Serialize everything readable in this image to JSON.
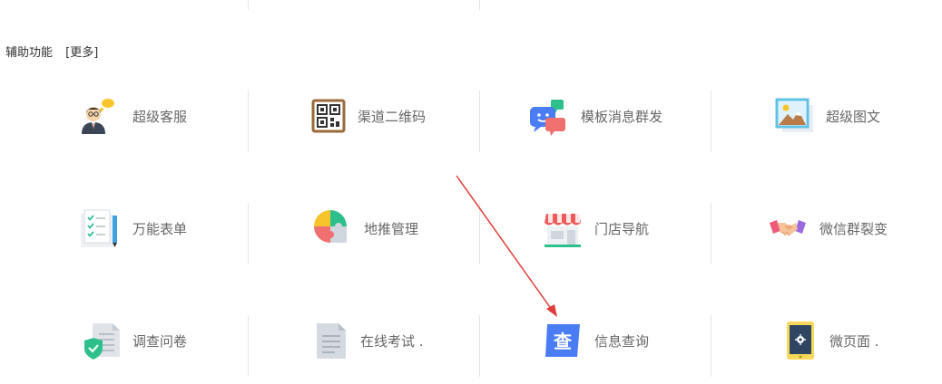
{
  "section": {
    "title": "辅助功能",
    "more_label": "[更多]"
  },
  "tiles": [
    {
      "label": "超级客服",
      "icon": "customer-service-icon"
    },
    {
      "label": "渠道二维码",
      "icon": "qr-code-icon"
    },
    {
      "label": "模板消息群发",
      "icon": "message-chat-icon"
    },
    {
      "label": "超级图文",
      "icon": "picture-article-icon"
    },
    {
      "label": "万能表单",
      "icon": "form-checklist-icon"
    },
    {
      "label": "地推管理",
      "icon": "puzzle-icon"
    },
    {
      "label": "门店导航",
      "icon": "store-icon"
    },
    {
      "label": "微信群裂变",
      "icon": "handshake-icon"
    },
    {
      "label": "调查问卷",
      "icon": "survey-shield-icon"
    },
    {
      "label": "在线考试 .",
      "icon": "exam-document-icon"
    },
    {
      "label": "信息查询",
      "icon": "query-icon"
    },
    {
      "label": "微页面 .",
      "icon": "phone-page-icon"
    }
  ],
  "query_icon_char": "查",
  "colors": {
    "annotation_arrow": "#e23b3b",
    "divider": "#e6e6e6",
    "label": "#666666"
  }
}
